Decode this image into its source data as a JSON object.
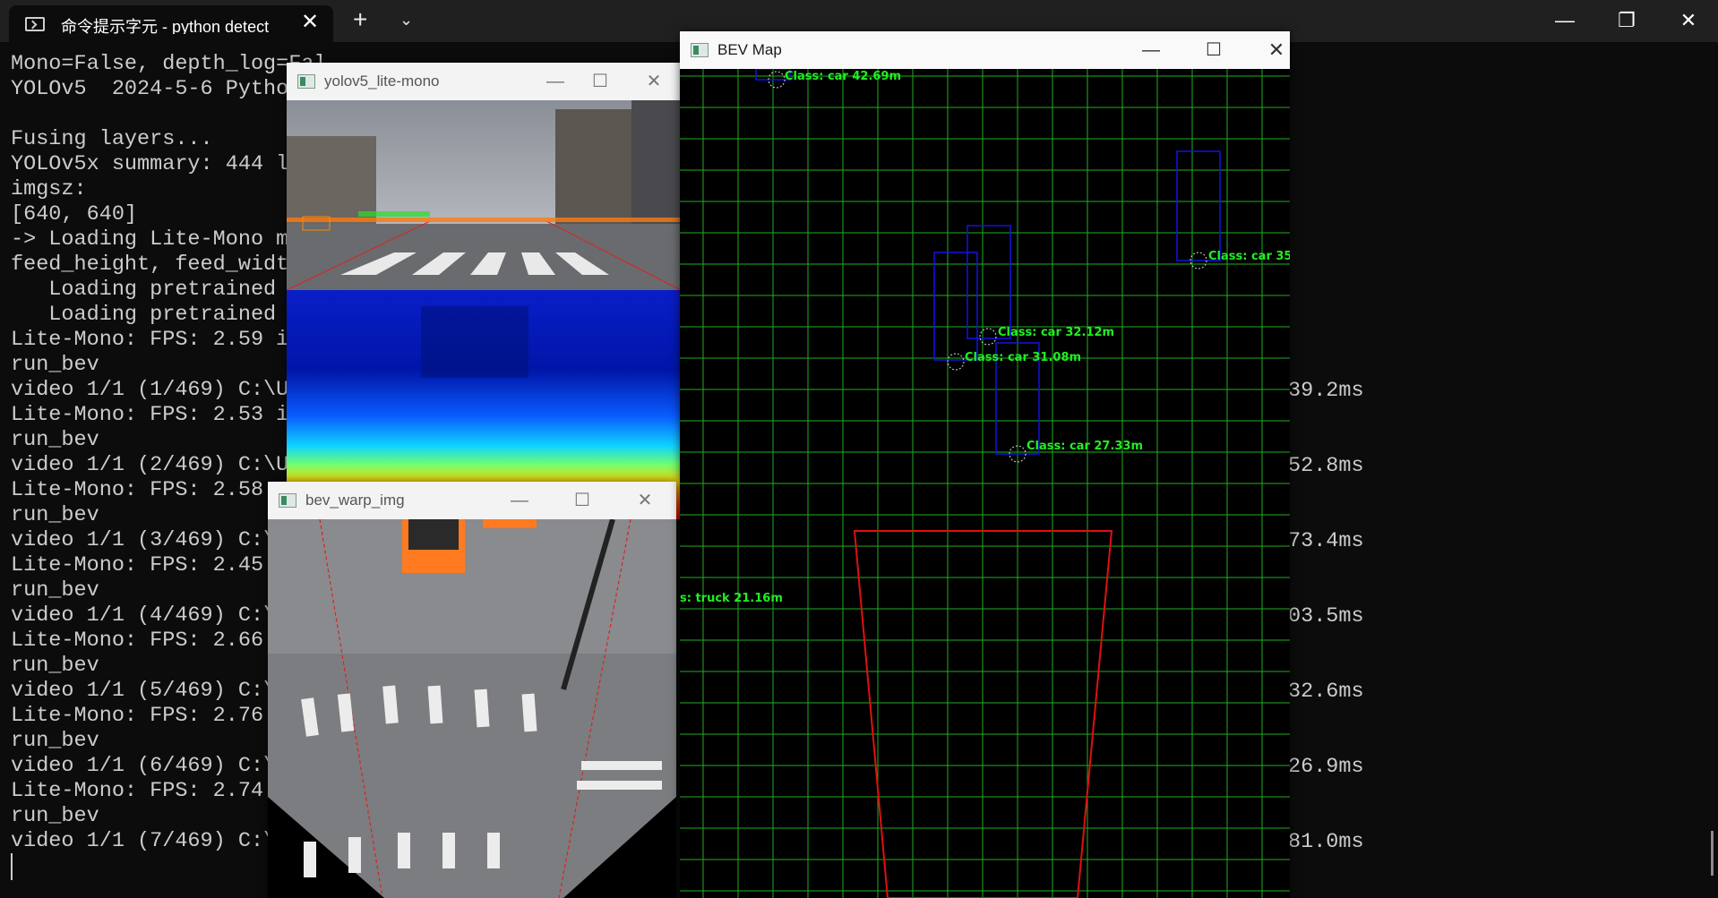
{
  "terminal": {
    "tab_title": "命令提示字元 - python detect",
    "new_tab_glyph": "+",
    "dropdown_glyph": "⌄",
    "close_glyph": "✕",
    "lines": [
      "Mono=False, depth_log=Fal",
      "YOLOv5  2024-5-6 Pytho",
      "",
      "Fusing layers...",
      "YOLOv5x summary: 444 l",
      "imgsz:",
      "[640, 640]",
      "-> Loading Lite-Mono m",
      "feed_height, feed_widt",
      "   Loading pretrained",
      "   Loading pretrained",
      "Lite-Mono: FPS: 2.59 i",
      "run_bev",
      "video 1/1 (1/469) C:\\U",
      "Lite-Mono: FPS: 2.53 i",
      "run_bev",
      "video 1/1 (2/469) C:\\U",
      "Lite-Mono: FPS: 2.58",
      "run_bev",
      "video 1/1 (3/469) C:\\",
      "Lite-Mono: FPS: 2.45",
      "run_bev",
      "video 1/1 (4/469) C:\\",
      "Lite-Mono: FPS: 2.66",
      "run_bev",
      "video 1/1 (5/469) C:\\",
      "Lite-Mono: FPS: 2.76",
      "run_bev",
      "video 1/1 (6/469) C:\\",
      "Lite-Mono: FPS: 2.74",
      "run_bev",
      "video 1/1 (7/469) C:\\"
    ],
    "right_times": [
      "39.2ms",
      "52.8ms",
      "73.4ms",
      "03.5ms",
      "32.6ms",
      "26.9ms",
      "81.0ms"
    ]
  },
  "window_controls": {
    "minimize": "—",
    "maximize": "☐",
    "restore": "❐",
    "close": "✕"
  },
  "yolo_window": {
    "title": "yolov5_lite-mono"
  },
  "warp_window": {
    "title": "bev_warp_img"
  },
  "bev_window": {
    "title": "BEV Map",
    "labels": {
      "car1": "Class: car 42.69m",
      "car2": "Class: car 35",
      "car3": "Class: car 32.12m",
      "car4": "Class: car 31.08m",
      "car5": "Class: car 27.33m",
      "truck": "s: truck 21.16m"
    }
  },
  "colors": {
    "grid": "#1fae1f",
    "box": "#1212e6",
    "roi": "#e01010",
    "label": "#22ee22"
  }
}
